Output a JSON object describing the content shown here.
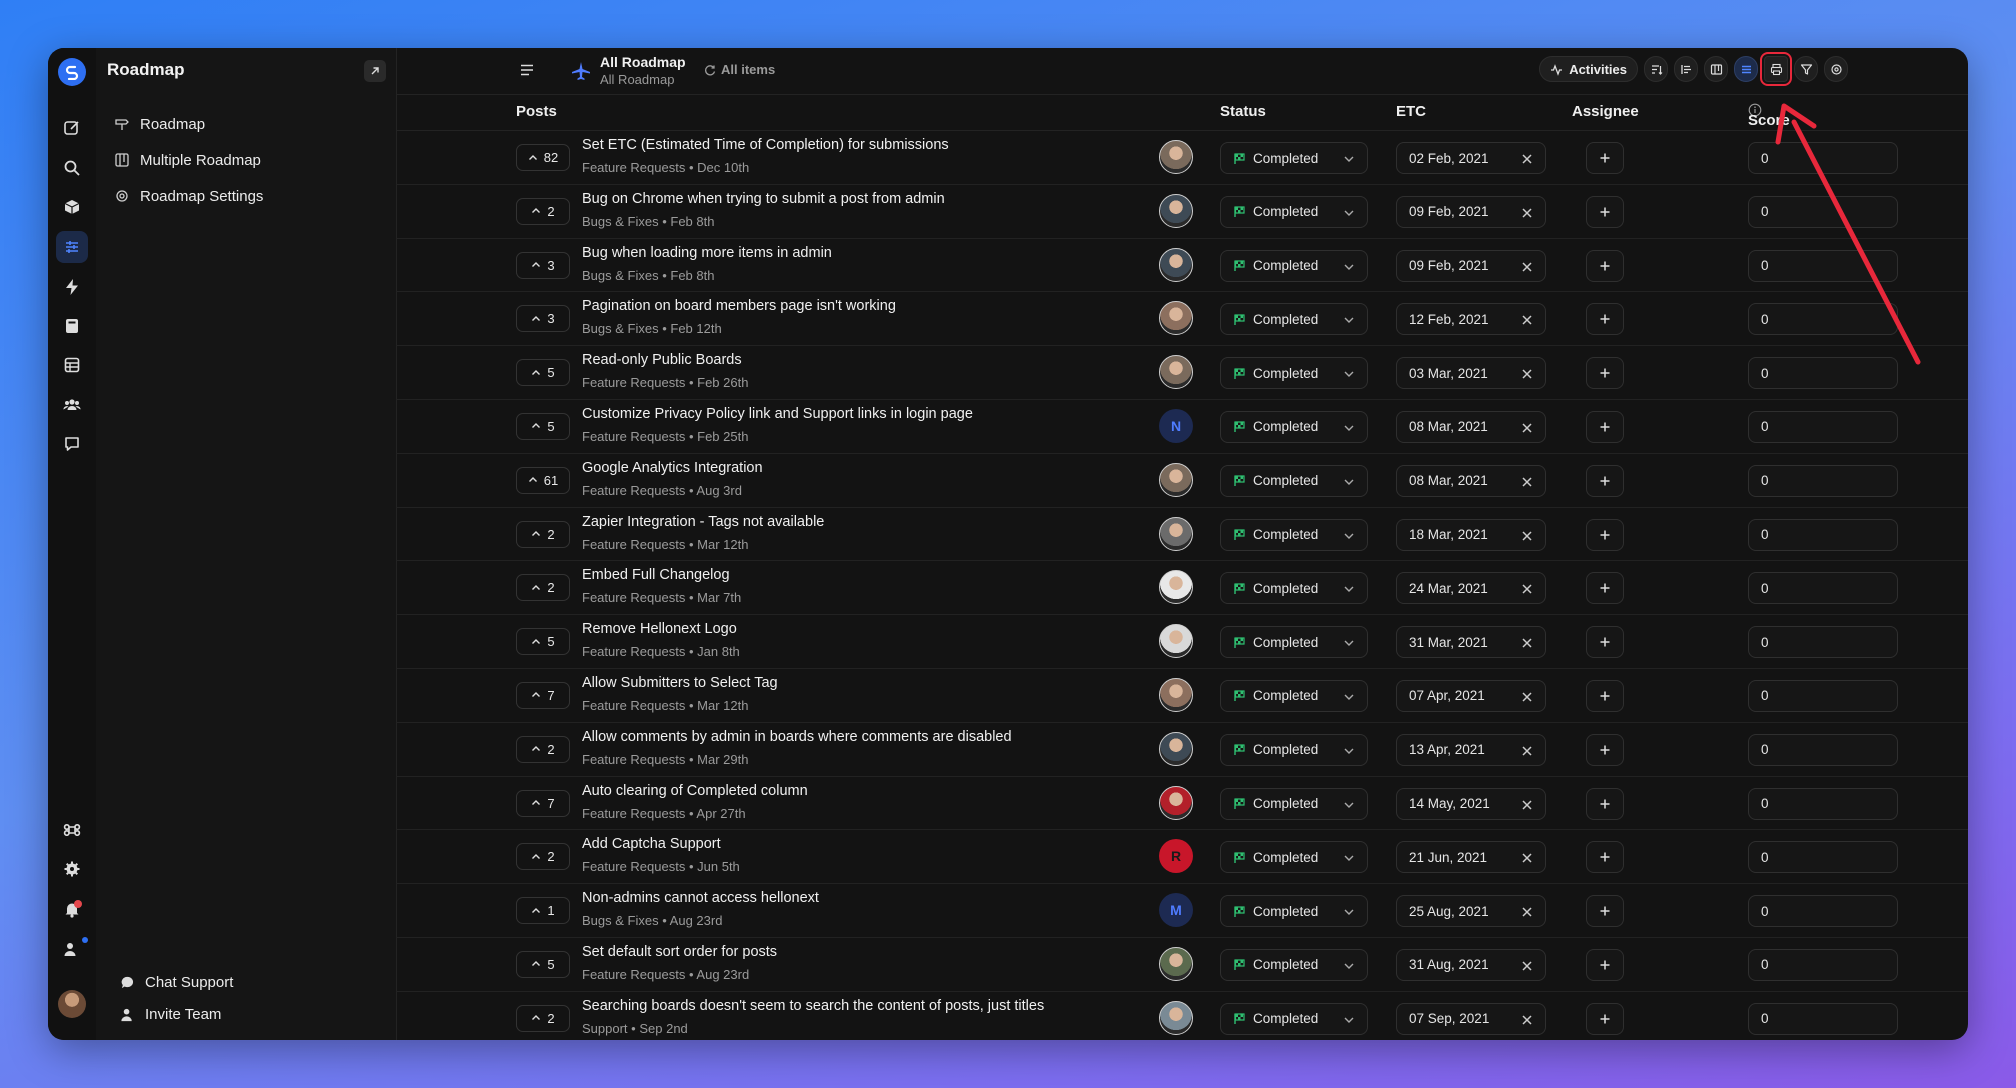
{
  "sidebar": {
    "title": "Roadmap",
    "nav": [
      {
        "label": "Roadmap",
        "icon": "signpost-icon"
      },
      {
        "label": "Multiple Roadmap",
        "icon": "boards-icon"
      },
      {
        "label": "Roadmap Settings",
        "icon": "gear-icon"
      }
    ],
    "bottom": [
      {
        "label": "Chat Support",
        "icon": "chat-icon"
      },
      {
        "label": "Invite Team",
        "icon": "user-plus-icon"
      }
    ]
  },
  "header": {
    "board_title": "All Roadmap",
    "board_subtitle": "All Roadmap",
    "all_items": "All items",
    "activities": "Activities"
  },
  "table": {
    "headers": {
      "posts": "Posts",
      "status": "Status",
      "etc": "ETC",
      "assignee": "Assignee",
      "score": "Score"
    },
    "rows": [
      {
        "votes": "82",
        "title": "Set ETC (Estimated Time of Completion) for submissions",
        "category": "Feature Requests",
        "date": "Dec 10th",
        "avatar": {
          "type": "photo",
          "color": "#7a6a5c"
        },
        "status": "Completed",
        "etc": "02 Feb, 2021",
        "score": "0"
      },
      {
        "votes": "2",
        "title": "Bug on Chrome when trying to submit a post from admin",
        "category": "Bugs & Fixes",
        "date": "Feb 8th",
        "avatar": {
          "type": "photo",
          "color": "#3e4a55"
        },
        "status": "Completed",
        "etc": "09 Feb, 2021",
        "score": "0"
      },
      {
        "votes": "3",
        "title": "Bug when loading more items in admin",
        "category": "Bugs & Fixes",
        "date": "Feb 8th",
        "avatar": {
          "type": "photo",
          "color": "#3e4a55"
        },
        "status": "Completed",
        "etc": "09 Feb, 2021",
        "score": "0"
      },
      {
        "votes": "3",
        "title": "Pagination on board members page isn't working",
        "category": "Bugs & Fixes",
        "date": "Feb 12th",
        "avatar": {
          "type": "photo",
          "color": "#8c6f5e"
        },
        "status": "Completed",
        "etc": "12 Feb, 2021",
        "score": "0"
      },
      {
        "votes": "5",
        "title": "Read-only Public Boards",
        "category": "Feature Requests",
        "date": "Feb 26th",
        "avatar": {
          "type": "photo",
          "color": "#7a6a5c"
        },
        "status": "Completed",
        "etc": "03 Mar, 2021",
        "score": "0"
      },
      {
        "votes": "5",
        "title": "Customize Privacy Policy link and Support links in login page",
        "category": "Feature Requests",
        "date": "Feb 25th",
        "avatar": {
          "type": "letter",
          "letter": "N",
          "color": "#1d2a52",
          "text": "#4f7cff"
        },
        "status": "Completed",
        "etc": "08 Mar, 2021",
        "score": "0"
      },
      {
        "votes": "61",
        "title": "Google Analytics Integration",
        "category": "Feature Requests",
        "date": "Aug 3rd",
        "avatar": {
          "type": "photo",
          "color": "#7a6a5c"
        },
        "status": "Completed",
        "etc": "08 Mar, 2021",
        "score": "0"
      },
      {
        "votes": "2",
        "title": "Zapier Integration - Tags not available",
        "category": "Feature Requests",
        "date": "Mar 12th",
        "avatar": {
          "type": "photo",
          "color": "#6b6b6b"
        },
        "status": "Completed",
        "etc": "18 Mar, 2021",
        "score": "0"
      },
      {
        "votes": "2",
        "title": "Embed Full Changelog",
        "category": "Feature Requests",
        "date": "Mar 7th",
        "avatar": {
          "type": "photo",
          "color": "#e8e8e8"
        },
        "status": "Completed",
        "etc": "24 Mar, 2021",
        "score": "0"
      },
      {
        "votes": "5",
        "title": "Remove Hellonext Logo",
        "category": "Feature Requests",
        "date": "Jan 8th",
        "avatar": {
          "type": "photo",
          "color": "#d9d9d9"
        },
        "status": "Completed",
        "etc": "31 Mar, 2021",
        "score": "0"
      },
      {
        "votes": "7",
        "title": "Allow Submitters to Select Tag",
        "category": "Feature Requests",
        "date": "Mar 12th",
        "avatar": {
          "type": "photo",
          "color": "#8c6f5e"
        },
        "status": "Completed",
        "etc": "07 Apr, 2021",
        "score": "0"
      },
      {
        "votes": "2",
        "title": "Allow comments by admin in boards where comments are disabled",
        "category": "Feature Requests",
        "date": "Mar 29th",
        "avatar": {
          "type": "photo",
          "color": "#3e4a55"
        },
        "status": "Completed",
        "etc": "13 Apr, 2021",
        "score": "0"
      },
      {
        "votes": "7",
        "title": "Auto clearing of Completed column",
        "category": "Feature Requests",
        "date": "Apr 27th",
        "avatar": {
          "type": "photo",
          "color": "#b3202a"
        },
        "status": "Completed",
        "etc": "14 May, 2021",
        "score": "0"
      },
      {
        "votes": "2",
        "title": "Add Captcha Support",
        "category": "Feature Requests",
        "date": "Jun 5th",
        "avatar": {
          "type": "letter",
          "letter": "R",
          "color": "#c8162a",
          "text": "#1a1a1a"
        },
        "status": "Completed",
        "etc": "21 Jun, 2021",
        "score": "0"
      },
      {
        "votes": "1",
        "title": "Non-admins cannot access hellonext",
        "category": "Bugs & Fixes",
        "date": "Aug 23rd",
        "avatar": {
          "type": "letter",
          "letter": "M",
          "color": "#1d2a52",
          "text": "#4f7cff"
        },
        "status": "Completed",
        "etc": "25 Aug, 2021",
        "score": "0"
      },
      {
        "votes": "5",
        "title": "Set default sort order for posts",
        "category": "Feature Requests",
        "date": "Aug 23rd",
        "avatar": {
          "type": "photo",
          "color": "#5b6a4e"
        },
        "status": "Completed",
        "etc": "31 Aug, 2021",
        "score": "0"
      },
      {
        "votes": "2",
        "title": "Searching boards doesn't seem to search the content of posts, just titles",
        "category": "Support",
        "date": "Sep 2nd",
        "avatar": {
          "type": "photo",
          "color": "#7a8a95"
        },
        "status": "Completed",
        "etc": "07 Sep, 2021",
        "score": "0"
      }
    ]
  },
  "colors": {
    "accent": "#2e6ff2",
    "status_green": "#2fbf71",
    "annotation_red": "#e8283b"
  }
}
